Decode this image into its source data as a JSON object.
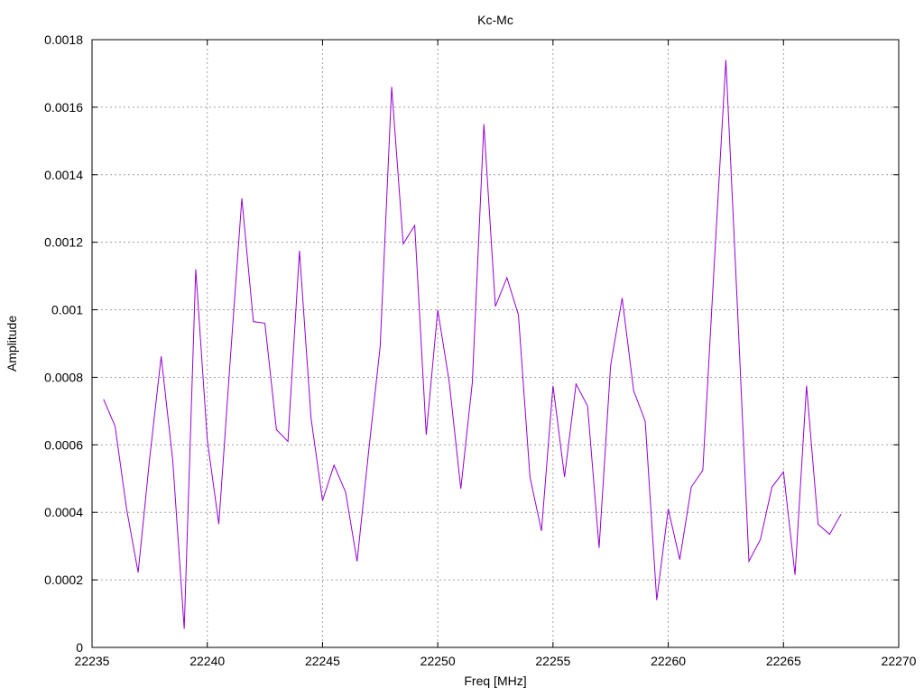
{
  "chart_data": {
    "type": "line",
    "title": "Kc-Mc",
    "xlabel": "Freq [MHz]",
    "ylabel": "Amplitude",
    "xlim": [
      22235,
      22270
    ],
    "ylim": [
      0,
      0.0018
    ],
    "grid": true,
    "x_ticks": [
      22235,
      22240,
      22245,
      22250,
      22255,
      22260,
      22265,
      22270
    ],
    "y_ticks": [
      0,
      0.0002,
      0.0004,
      0.0006,
      0.0008,
      0.001,
      0.0012,
      0.0014,
      0.0016,
      0.0018
    ],
    "x_tick_labels": [
      "22235",
      "22240",
      "22245",
      "22250",
      "22255",
      "22260",
      "22265",
      "22270"
    ],
    "y_tick_labels": [
      "0",
      "0.0002",
      "0.0004",
      "0.0006",
      "0.0008",
      "0.001",
      "0.0012",
      "0.0014",
      "0.0016",
      "0.0018"
    ],
    "series": [
      {
        "color": "#9400d3",
        "x": [
          22235.5,
          22236,
          22236.5,
          22237,
          22237.5,
          22238,
          22238.5,
          22239,
          22239.5,
          22240,
          22240.5,
          22241,
          22241.5,
          22242,
          22242.5,
          22243,
          22243.5,
          22244,
          22244.5,
          22245,
          22245.5,
          22246,
          22246.5,
          22247,
          22247.5,
          22248,
          22248.5,
          22249,
          22249.5,
          22250,
          22250.5,
          22251,
          22251.5,
          22252,
          22252.5,
          22253,
          22253.5,
          22254,
          22254.5,
          22255,
          22255.5,
          22256,
          22256.5,
          22257,
          22257.5,
          22258,
          22258.5,
          22259,
          22259.5,
          22260,
          22260.5,
          22261,
          22261.5,
          22262,
          22262.5,
          22263,
          22263.5,
          22264,
          22264.5,
          22265,
          22265.5,
          22266,
          22266.5,
          22267,
          22267.5
        ],
        "y": [
          0.000735,
          0.000655,
          0.00041,
          0.000222,
          0.00056,
          0.000862,
          0.000555,
          5.5e-05,
          0.00112,
          0.000615,
          0.000365,
          0.000855,
          0.00133,
          0.000965,
          0.00096,
          0.000645,
          0.00061,
          0.001175,
          0.00068,
          0.000435,
          0.00054,
          0.00046,
          0.000255,
          0.00058,
          0.00089,
          0.00166,
          0.001195,
          0.00125,
          0.00063,
          0.001,
          0.000785,
          0.00047,
          0.000785,
          0.00155,
          0.00101,
          0.001095,
          0.000985,
          0.000505,
          0.000345,
          0.000775,
          0.000505,
          0.00078,
          0.000715,
          0.000295,
          0.000835,
          0.001035,
          0.00076,
          0.00067,
          0.00014,
          0.00041,
          0.00026,
          0.000475,
          0.000525,
          0.00114,
          0.00174,
          0.00101,
          0.000255,
          0.00032,
          0.000475,
          0.00052,
          0.000215,
          0.000775,
          0.000365,
          0.000335,
          0.000395
        ]
      }
    ]
  }
}
